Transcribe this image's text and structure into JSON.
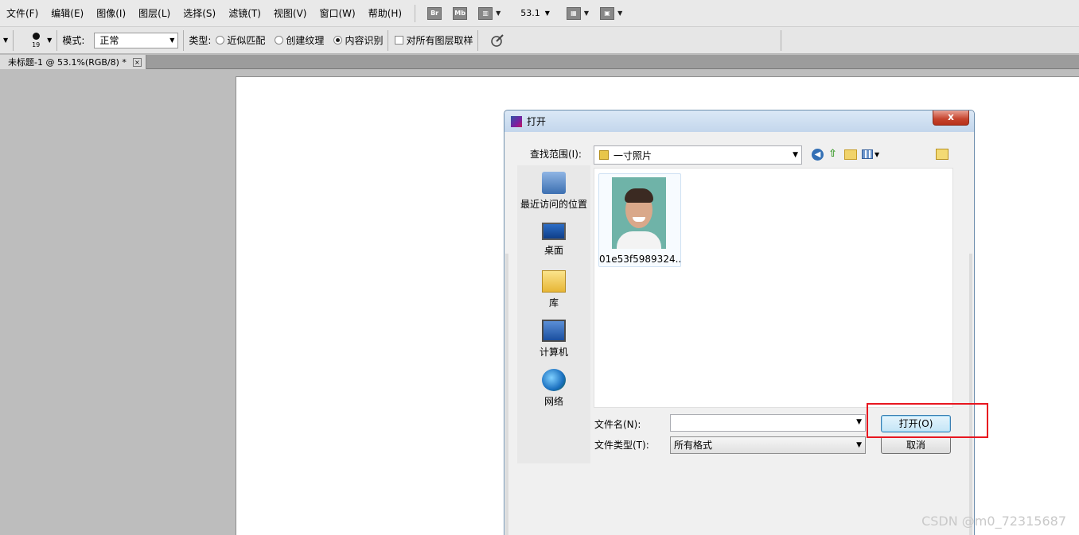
{
  "menubar": {
    "items": [
      "文件(F)",
      "编辑(E)",
      "图像(I)",
      "图层(L)",
      "选择(S)",
      "滤镜(T)",
      "视图(V)",
      "窗口(W)",
      "帮助(H)"
    ],
    "br_label": "Br",
    "mb_label": "Mb",
    "zoom": "53.1"
  },
  "options": {
    "brush_size": "19",
    "mode_label": "模式:",
    "mode_value": "正常",
    "type_label": "类型:",
    "radio_proximity": "近似匹配",
    "radio_texture": "创建纹理",
    "radio_content": "内容识别",
    "sample_all": "对所有图层取样"
  },
  "document": {
    "tab_title": "未标题-1 @ 53.1%(RGB/8) *"
  },
  "dialog": {
    "title": "打开",
    "close_glyph": "x",
    "look_in_label": "查找范围(I):",
    "look_in_value": "一寸照片",
    "places": [
      "最近访问的位置",
      "桌面",
      "库",
      "计算机",
      "网络"
    ],
    "files": [
      {
        "name": "01e53f5989324..."
      }
    ],
    "filename_label": "文件名(N):",
    "filename_value": "",
    "filetype_label": "文件类型(T):",
    "filetype_value": "所有格式",
    "open_button": "打开(O)",
    "cancel_button": "取消"
  },
  "watermark": "CSDN @m0_72315687",
  "colors": {
    "highlight_border": "#e8161f",
    "dialog_title_bg": "#c3d6ec",
    "close_button": "#c5432c"
  }
}
